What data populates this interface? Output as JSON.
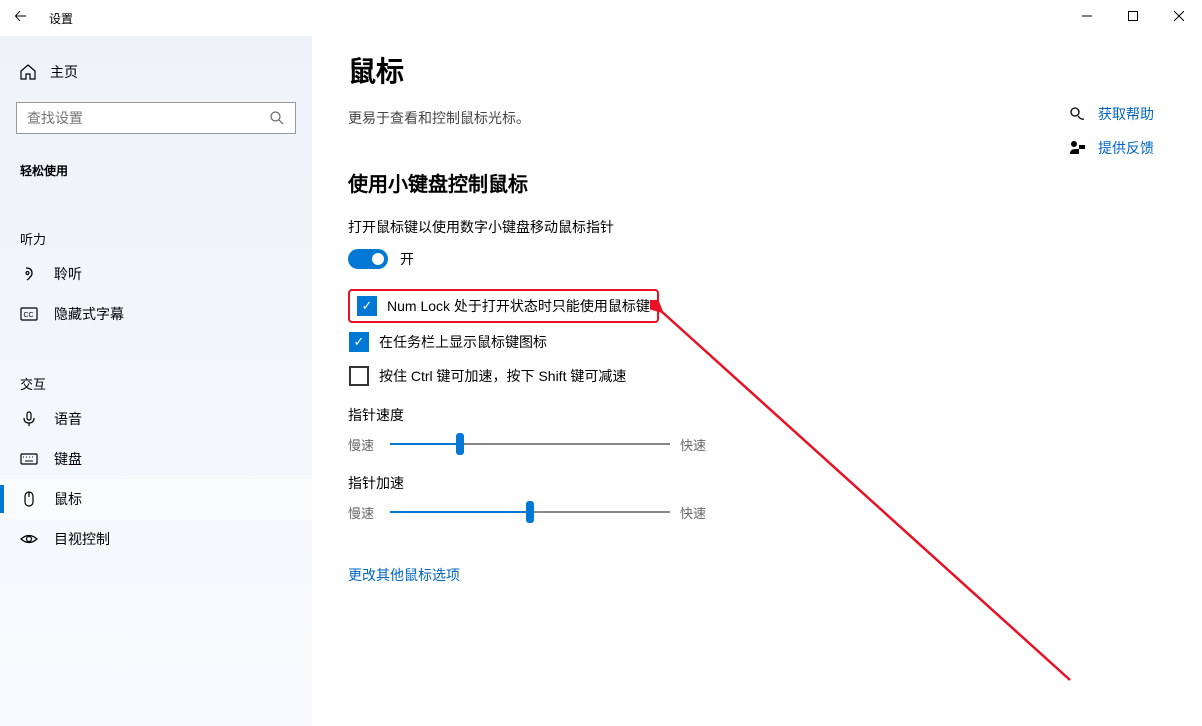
{
  "window": {
    "title": "设置"
  },
  "sidebar": {
    "home": "主页",
    "search_placeholder": "查找设置",
    "category": "轻松使用",
    "section_hearing": "听力",
    "section_interaction": "交互",
    "items": {
      "hearing": "聆听",
      "captions": "隐藏式字幕",
      "speech": "语音",
      "keyboard": "键盘",
      "mouse": "鼠标",
      "eye": "目视控制"
    }
  },
  "page": {
    "title": "鼠标",
    "subtitle": "更易于查看和控制鼠标光标。",
    "section": "使用小键盘控制鼠标",
    "toggle_desc": "打开鼠标键以使用数字小键盘移动鼠标指针",
    "toggle_state": "开",
    "check_numlock": "Num Lock 处于打开状态时只能使用鼠标键",
    "check_taskbar": "在任务栏上显示鼠标键图标",
    "check_ctrl": "按住 Ctrl 键可加速，按下 Shift 键可减速",
    "slider_speed": {
      "label": "指针速度",
      "min": "慢速",
      "max": "快速",
      "value": 25
    },
    "slider_accel": {
      "label": "指针加速",
      "min": "慢速",
      "max": "快速",
      "value": 50
    },
    "link_more": "更改其他鼠标选项"
  },
  "right": {
    "help": "获取帮助",
    "feedback": "提供反馈"
  }
}
